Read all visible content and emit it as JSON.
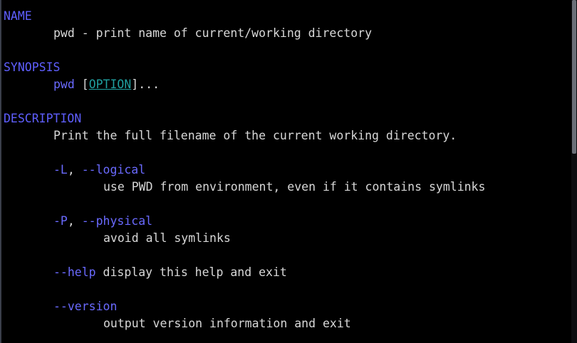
{
  "colors": {
    "background": "#000000",
    "text": "#d8d8d8",
    "heading": "#5f5fff",
    "option": "#6a6aff",
    "argument": "#20a0a0"
  },
  "man": {
    "name": {
      "heading": "NAME",
      "text": "pwd - print name of current/working directory"
    },
    "synopsis": {
      "heading": "SYNOPSIS",
      "command": "pwd",
      "bracket_open": " [",
      "option_arg": "OPTION",
      "bracket_close": "]..."
    },
    "description": {
      "heading": "DESCRIPTION",
      "text": "Print the full filename of the current working directory.",
      "options": [
        {
          "short": "-L",
          "sep": ", ",
          "long": "--logical",
          "desc": "use PWD from environment, even if it contains symlinks"
        },
        {
          "short": "-P",
          "sep": ", ",
          "long": "--physical",
          "desc": "avoid all symlinks"
        },
        {
          "long": "--help",
          "desc": " display this help and exit"
        },
        {
          "long": "--version",
          "desc": "output version information and exit"
        }
      ]
    }
  }
}
